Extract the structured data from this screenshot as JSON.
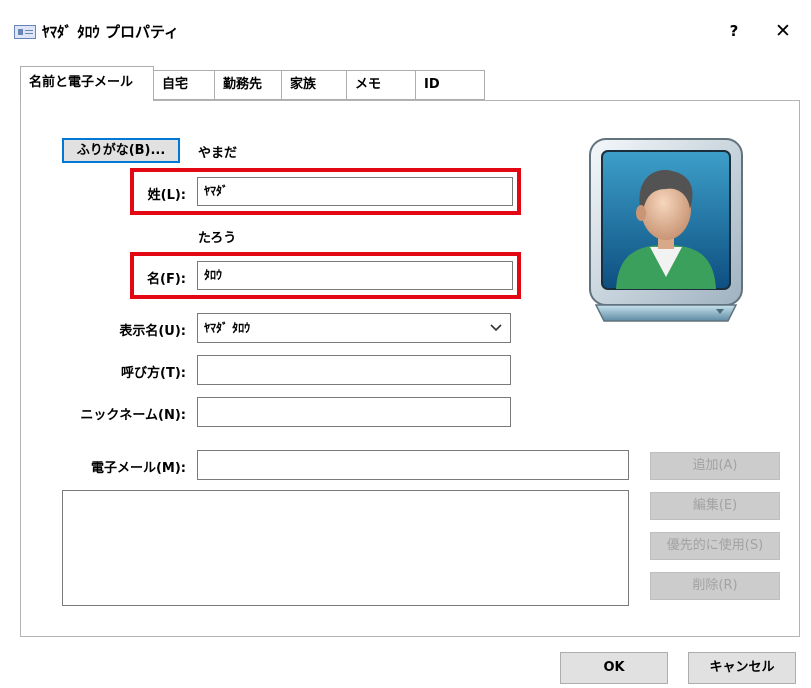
{
  "window": {
    "title": "ﾔﾏﾀﾞ ﾀﾛｳ プロパティ",
    "help": "?",
    "close": "✕"
  },
  "tabs": [
    {
      "label": "名前と電子メール",
      "active": true
    },
    {
      "label": "自宅"
    },
    {
      "label": "勤務先"
    },
    {
      "label": "家族"
    },
    {
      "label": "メモ"
    },
    {
      "label": "ID"
    }
  ],
  "name": {
    "furigana_button": "ふりがな(B)...",
    "last_reading": "やまだ",
    "last_label": "姓(L):",
    "last_value": "ﾔﾏﾀﾞ",
    "first_reading": "たろう",
    "first_label": "名(F):",
    "first_value": "ﾀﾛｳ",
    "display_label": "表示名(U):",
    "display_value": "ﾔﾏﾀﾞ ﾀﾛｳ",
    "nickname_call_label": "呼び方(T):",
    "nickname_call_value": "",
    "nickname_label": "ニックネーム(N):",
    "nickname_value": ""
  },
  "email": {
    "label": "電子メール(M):",
    "value": "",
    "list": [],
    "add_button": "追加(A)",
    "edit_button": "編集(E)",
    "default_button": "優先的に使用(S)",
    "delete_button": "削除(R)"
  },
  "footer": {
    "ok_button": "OK",
    "cancel_button": "キャンセル"
  },
  "highlight_color": "#e30613"
}
